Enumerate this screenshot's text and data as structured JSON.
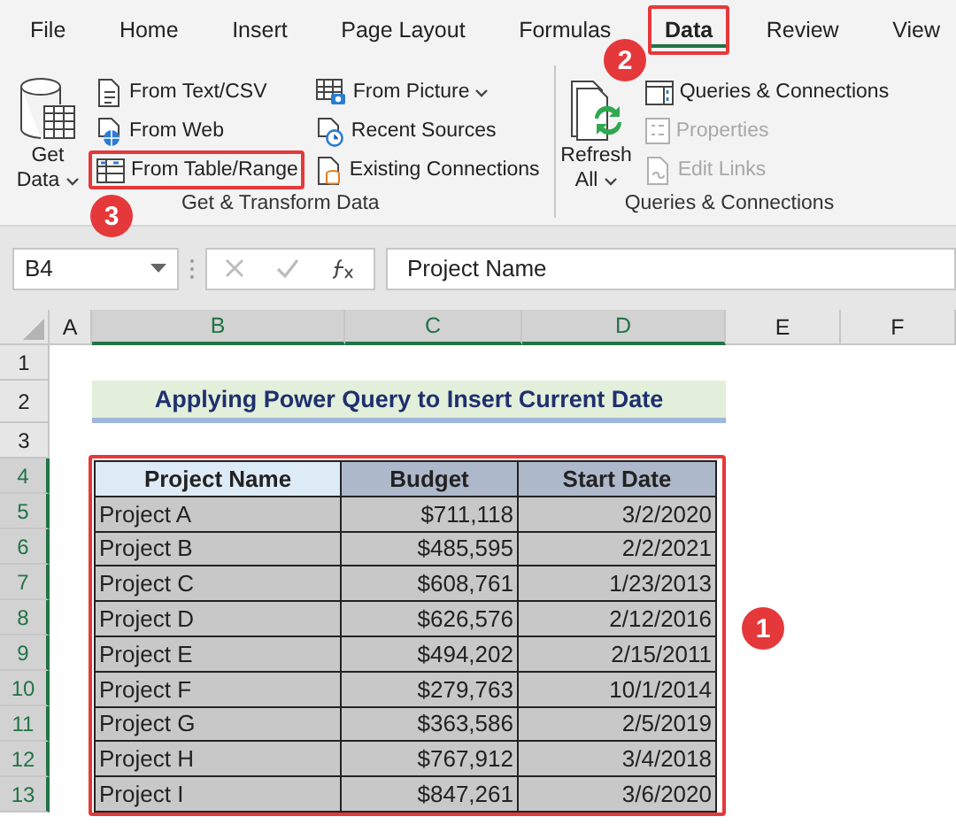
{
  "ribbon": {
    "tabs": [
      {
        "label": "File",
        "selected": false,
        "highlighted": false
      },
      {
        "label": "Home",
        "selected": false,
        "highlighted": false
      },
      {
        "label": "Insert",
        "selected": false,
        "highlighted": false
      },
      {
        "label": "Page Layout",
        "selected": false,
        "highlighted": false
      },
      {
        "label": "Formulas",
        "selected": false,
        "highlighted": false
      },
      {
        "label": "Data",
        "selected": true,
        "highlighted": true
      },
      {
        "label": "Review",
        "selected": false,
        "highlighted": false
      },
      {
        "label": "View",
        "selected": false,
        "highlighted": false
      }
    ],
    "groups": [
      {
        "title": "Get & Transform Data",
        "large": {
          "lines": [
            "Get",
            "Data"
          ],
          "dropdown": true
        },
        "items": [
          {
            "label": "From Text/CSV",
            "disabled": false,
            "dropdown": false,
            "highlighted": false
          },
          {
            "label": "From Web",
            "disabled": false,
            "dropdown": false,
            "highlighted": false
          },
          {
            "label": "From Table/Range",
            "disabled": false,
            "dropdown": false,
            "highlighted": true
          },
          {
            "label": "From Picture",
            "disabled": false,
            "dropdown": true,
            "highlighted": false
          },
          {
            "label": "Recent Sources",
            "disabled": false,
            "dropdown": false,
            "highlighted": false
          },
          {
            "label": "Existing Connections",
            "disabled": false,
            "dropdown": false,
            "highlighted": false
          }
        ]
      },
      {
        "title": "Queries & Connections",
        "large": {
          "lines": [
            "Refresh",
            "All"
          ],
          "dropdown": true
        },
        "items": [
          {
            "label": "Queries & Connections",
            "disabled": false,
            "dropdown": false,
            "highlighted": false
          },
          {
            "label": "Properties",
            "disabled": true,
            "dropdown": false,
            "highlighted": false
          },
          {
            "label": "Edit Links",
            "disabled": true,
            "dropdown": false,
            "highlighted": false
          }
        ]
      }
    ]
  },
  "formula_bar": {
    "name_box": "B4",
    "formula": "Project Name"
  },
  "sheet": {
    "columns": [
      {
        "label": "A",
        "selected": false
      },
      {
        "label": "B",
        "selected": true
      },
      {
        "label": "C",
        "selected": true
      },
      {
        "label": "D",
        "selected": true
      },
      {
        "label": "E",
        "selected": false
      },
      {
        "label": "F",
        "selected": false
      }
    ],
    "rows": [
      {
        "label": "1",
        "selected": false
      },
      {
        "label": "2",
        "selected": false
      },
      {
        "label": "3",
        "selected": false
      },
      {
        "label": "4",
        "selected": true
      },
      {
        "label": "5",
        "selected": true
      },
      {
        "label": "6",
        "selected": true
      },
      {
        "label": "7",
        "selected": true
      },
      {
        "label": "8",
        "selected": true
      },
      {
        "label": "9",
        "selected": true
      },
      {
        "label": "10",
        "selected": true
      },
      {
        "label": "11",
        "selected": true
      },
      {
        "label": "12",
        "selected": true
      },
      {
        "label": "13",
        "selected": true
      }
    ],
    "title": "Applying Power Query to Insert Current Date",
    "table": {
      "highlighted": true,
      "columns": [
        "Project Name",
        "Budget",
        "Start Date"
      ],
      "rows": [
        [
          "Project A",
          "$711,118",
          "3/2/2020"
        ],
        [
          "Project B",
          "$485,595",
          "2/2/2021"
        ],
        [
          "Project C",
          "$608,761",
          "1/23/2013"
        ],
        [
          "Project D",
          "$626,576",
          "2/12/2016"
        ],
        [
          "Project E",
          "$494,202",
          "2/15/2011"
        ],
        [
          "Project F",
          "$279,763",
          "10/1/2014"
        ],
        [
          "Project G",
          "$363,586",
          "2/5/2019"
        ],
        [
          "Project H",
          "$767,912",
          "3/4/2018"
        ],
        [
          "Project I",
          "$847,261",
          "3/6/2020"
        ]
      ]
    }
  },
  "callouts": [
    {
      "label": "2"
    },
    {
      "label": "3"
    },
    {
      "label": "1"
    }
  ]
}
